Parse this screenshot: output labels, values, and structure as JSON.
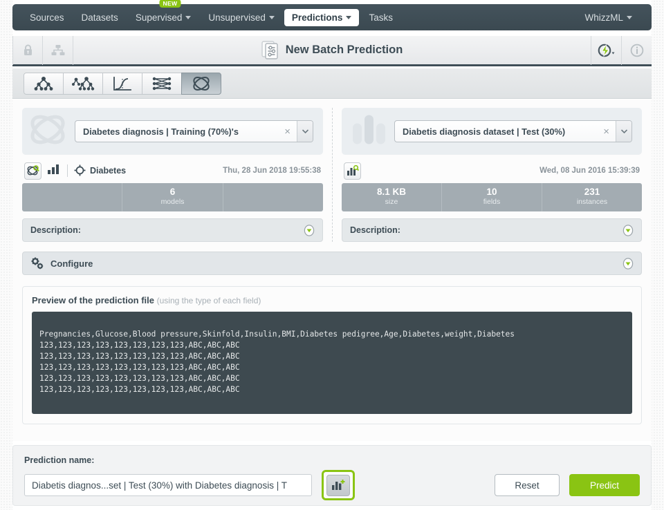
{
  "nav": {
    "items": [
      {
        "label": "Sources",
        "dropdown": false,
        "active": false,
        "badge": null
      },
      {
        "label": "Datasets",
        "dropdown": false,
        "active": false,
        "badge": null
      },
      {
        "label": "Supervised",
        "dropdown": true,
        "active": false,
        "badge": "NEW"
      },
      {
        "label": "Unsupervised",
        "dropdown": true,
        "active": false,
        "badge": null
      },
      {
        "label": "Predictions",
        "dropdown": true,
        "active": true,
        "badge": null
      },
      {
        "label": "Tasks",
        "dropdown": false,
        "active": false,
        "badge": null
      }
    ],
    "account": {
      "label": "WhizzML",
      "dropdown": true
    }
  },
  "header": {
    "title": "New Batch Prediction",
    "left_icons": [
      "lock-icon",
      "share-network-icon"
    ],
    "right_icons": [
      "lightning-bolt-icon",
      "info-icon"
    ]
  },
  "type_toolbar": {
    "buttons": [
      {
        "name": "model-icon",
        "active": false
      },
      {
        "name": "ensemble-icon",
        "active": false
      },
      {
        "name": "logistic-regression-icon",
        "active": false
      },
      {
        "name": "deepnet-icon",
        "active": false
      },
      {
        "name": "fusion-icon",
        "active": true
      }
    ]
  },
  "left_panel": {
    "watermark_icon": "fusion-icon",
    "selector": {
      "value": "Diabetes diagnosis | Training (70%)'s",
      "placeholder": "Search fusion...",
      "clear_label": "×"
    },
    "meta": {
      "preview_icon": "fusion-search-icon",
      "chart_icon": "bar-chart-icon",
      "objective_icon": "target-icon",
      "objective_name": "Diabetes",
      "date": "Thu, 28 Jun 2018 19:55:38"
    },
    "stats": [
      {
        "value": "",
        "label": ""
      },
      {
        "value": "6",
        "label": "models"
      },
      {
        "value": "",
        "label": ""
      }
    ],
    "description_label": "Description:"
  },
  "right_panel": {
    "watermark_icon": "dataset-bars-icon",
    "selector": {
      "value": "Diabetis diagnosis dataset | Test (30%)",
      "placeholder": "Search dataset...",
      "clear_label": "×"
    },
    "meta": {
      "preview_icon": "dataset-search-icon",
      "date": "Wed, 08 Jun 2016 15:39:39"
    },
    "stats": [
      {
        "value": "8.1 KB",
        "label": "size"
      },
      {
        "value": "10",
        "label": "fields"
      },
      {
        "value": "231",
        "label": "instances"
      }
    ],
    "description_label": "Description:"
  },
  "configure": {
    "icon": "gears-icon",
    "label": "Configure"
  },
  "preview": {
    "title": "Preview of the prediction file",
    "subtitle": "(using the type of each field)",
    "lines": [
      "Pregnancies,Glucose,Blood pressure,Skinfold,Insulin,BMI,Diabetes pedigree,Age,Diabetes,weight,Diabetes",
      "123,123,123,123,123,123,123,123,ABC,ABC,ABC",
      "123,123,123,123,123,123,123,123,ABC,ABC,ABC",
      "123,123,123,123,123,123,123,123,ABC,ABC,ABC",
      "123,123,123,123,123,123,123,123,ABC,ABC,ABC",
      "123,123,123,123,123,123,123,123,ABC,ABC,ABC"
    ]
  },
  "footer": {
    "name_label": "Prediction name:",
    "name_value": "Diabetis diagnos...set | Test (30%) with Diabetes diagnosis | T",
    "name_placeholder": "Prediction name",
    "create_dataset_icon": "dataset-plus-icon",
    "reset_label": "Reset",
    "predict_label": "Predict"
  },
  "colors": {
    "accent_green": "#8ac413",
    "nav_dark": "#3f4e57",
    "code_bg": "#3e4a50",
    "stats_bg": "#a3acb2"
  }
}
